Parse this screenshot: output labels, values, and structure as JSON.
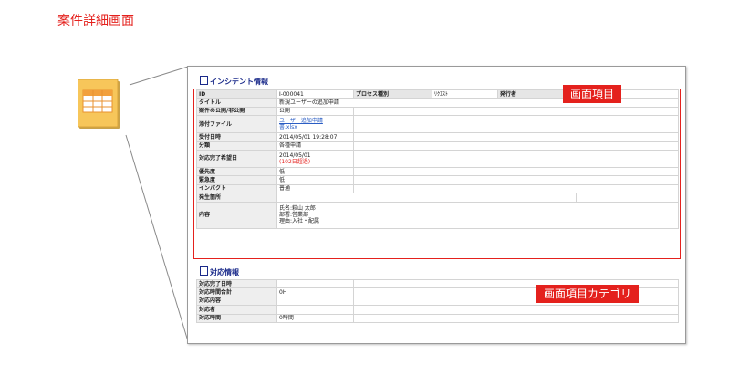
{
  "title": "案件詳細画面",
  "incident": {
    "heading": "インシデント情報",
    "id_label": "ID",
    "id_value": "I-000041",
    "process_label": "プロセス種別",
    "process_value": "ﾘｸｴｽﾄ",
    "issuer_label": "発行者",
    "issuer_value": "",
    "rows": [
      {
        "label": "タイトル",
        "lines": [
          "新規ユーザーの追加申請"
        ]
      },
      {
        "label": "案件の公開/非公開",
        "lines": [
          "公開"
        ]
      },
      {
        "label": "添付ファイル",
        "links": [
          "ユーザー追加申請",
          "書.xlsx"
        ]
      },
      {
        "label": "受付日時",
        "lines": [
          "2014/05/01 19:28:07"
        ]
      },
      {
        "label": "分類",
        "lines": [
          "各種申請"
        ]
      },
      {
        "label": "対応完了希望日",
        "lines": [
          "2014/05/01"
        ],
        "warn": "(102日超過)"
      },
      {
        "label": "優先度",
        "lines": [
          "低"
        ]
      },
      {
        "label": "緊急度",
        "lines": [
          "低"
        ]
      },
      {
        "label": "インパクト",
        "lines": [
          "普通"
        ]
      },
      {
        "label": "発生箇所",
        "lines": [
          ""
        ]
      },
      {
        "label": "内容",
        "lines": [
          "氏名:萩山 太郎",
          "部署:営業部",
          "理由:入社・配属"
        ]
      }
    ]
  },
  "response": {
    "heading": "対応情報",
    "rows": [
      {
        "label": "対応完了日時",
        "value": ""
      },
      {
        "label": "対応時間合計",
        "value": "0H"
      },
      {
        "label": "対応内容",
        "value": ""
      },
      {
        "label": "対応者",
        "value": ""
      },
      {
        "label": "対応時間",
        "value": "0時間"
      }
    ]
  },
  "callouts": {
    "items": "画面項目",
    "category": "画面項目カテゴリ"
  },
  "colors": {
    "accent": "#e4211d",
    "heading": "#1a2a8a",
    "icon_fill": "#f7c65a",
    "icon_header": "#f2a03c"
  },
  "icons": [
    "document-table-icon",
    "section-document-icon"
  ]
}
